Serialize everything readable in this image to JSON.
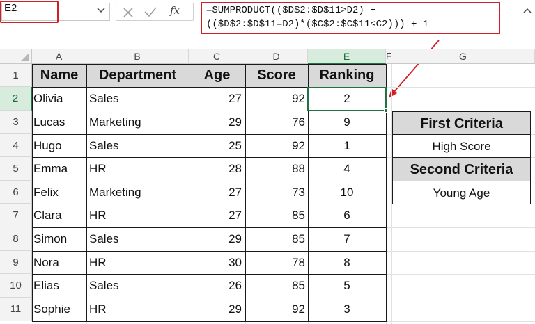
{
  "formula_bar": {
    "name_box": "E2",
    "fx_label": "fx",
    "formula_line1": "=SUMPRODUCT(($D$2:$D$11>D2) +",
    "formula_line2": "(($D$2:$D$11=D2)*($C$2:$C$11<C2))) + 1"
  },
  "columns": [
    "A",
    "B",
    "C",
    "D",
    "E",
    "F",
    "G"
  ],
  "rows": [
    "1",
    "2",
    "3",
    "4",
    "5",
    "6",
    "7",
    "8",
    "9",
    "10",
    "11"
  ],
  "selected_cell": "E2",
  "table": {
    "headers": [
      "Name",
      "Department",
      "Age",
      "Score",
      "Ranking"
    ],
    "rows": [
      [
        "Olivia",
        "Sales",
        "27",
        "92",
        "2"
      ],
      [
        "Lucas",
        "Marketing",
        "29",
        "76",
        "9"
      ],
      [
        "Hugo",
        "Sales",
        "25",
        "92",
        "1"
      ],
      [
        "Emma",
        "HR",
        "28",
        "88",
        "4"
      ],
      [
        "Felix",
        "Marketing",
        "27",
        "73",
        "10"
      ],
      [
        "Clara",
        "HR",
        "27",
        "85",
        "6"
      ],
      [
        "Simon",
        "Sales",
        "29",
        "85",
        "7"
      ],
      [
        "Nora",
        "HR",
        "30",
        "78",
        "8"
      ],
      [
        "Elias",
        "Sales",
        "26",
        "85",
        "5"
      ],
      [
        "Sophie",
        "HR",
        "29",
        "92",
        "3"
      ]
    ]
  },
  "criteria": {
    "first_header": "First Criteria",
    "first_value": "High Score",
    "second_header": "Second Criteria",
    "second_value": "Young Age"
  },
  "colors": {
    "highlight_red": "#d21f26",
    "selection_green": "#217346",
    "header_fill": "#d9d9d9"
  },
  "icons": [
    "chevron-down-icon",
    "cancel-icon",
    "enter-check-icon",
    "insert-function-icon",
    "chevron-up-icon",
    "arrow-annotation"
  ]
}
